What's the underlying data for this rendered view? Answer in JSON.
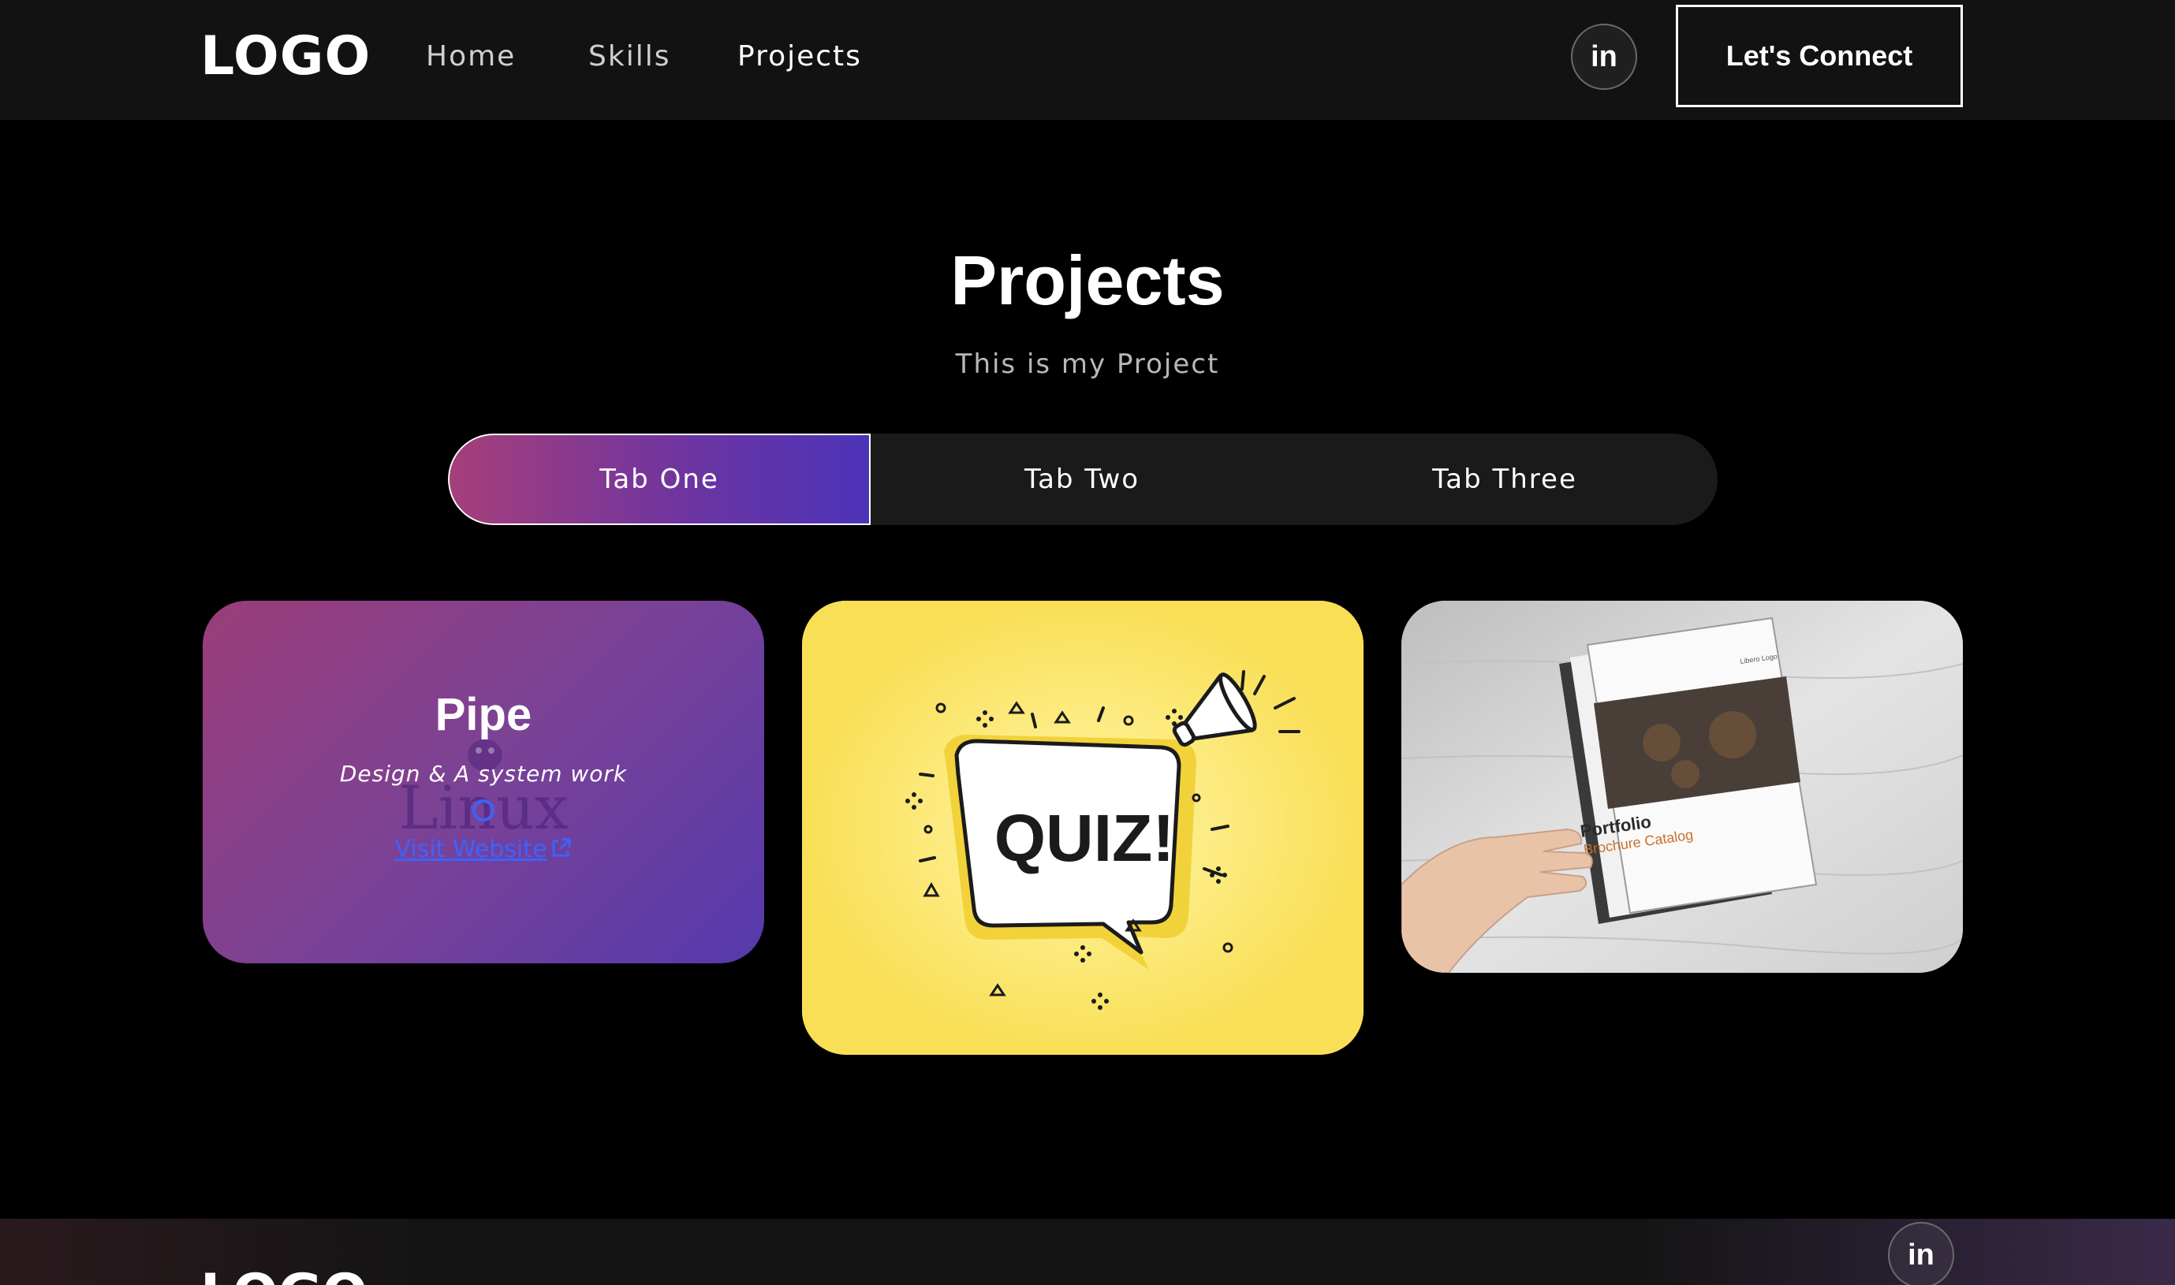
{
  "nav": {
    "logo": "LOGO",
    "links": [
      "Home",
      "Skills",
      "Projects"
    ],
    "social_icon": "linkedin-icon",
    "social_text": "in",
    "connect_label": "Let's Connect"
  },
  "projects": {
    "title": "Projects",
    "subtitle": "This is my Project",
    "tabs": [
      "Tab One",
      "Tab Two",
      "Tab Three"
    ],
    "active_tab": "Tab One"
  },
  "cards": [
    {
      "title": "Pipe",
      "description": "Design & A system work",
      "watermark": "Linux",
      "link": "Visit Website"
    },
    {
      "image_text": "QUIZ!"
    },
    {
      "cover_title": "Portfolio",
      "cover_subtitle": "Brochure Catalog",
      "cover_logo": "Libero Logo"
    }
  ],
  "footer": {
    "logo": "LOGO",
    "social_text": "in"
  },
  "colors": {
    "nav_bg": "#121212",
    "page_bg": "#000000",
    "accent_gradient_start": "#a63f7a",
    "accent_gradient_end": "#4c33b8",
    "quiz_yellow": "#f9df56",
    "link_blue": "#3b63ff"
  }
}
